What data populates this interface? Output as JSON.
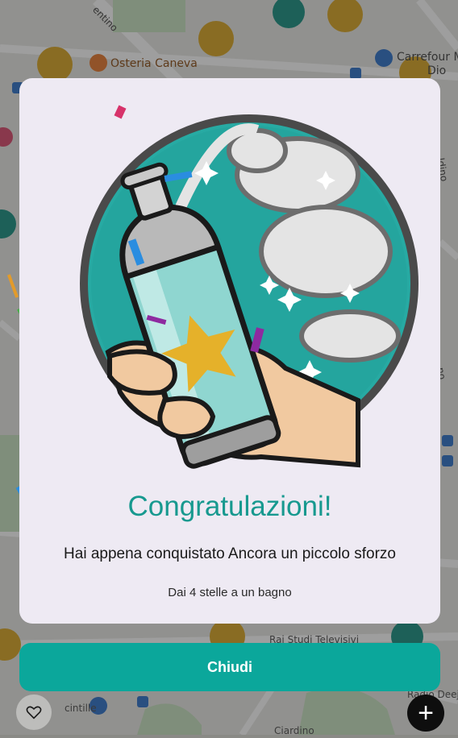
{
  "map": {
    "places": {
      "osteria": "Osteria Caneva",
      "carrefour_line1": "Carrefour M",
      "carrefour_line2": "Dio",
      "rai": "Rai Studi Televisivi",
      "radio": "Radio Deejay",
      "street_bottom": "cintille",
      "street_top": "entino",
      "street_right": "ldino",
      "street_right2": "no",
      "street_bottom2": "Ciardino"
    }
  },
  "dialog": {
    "title": "Congratulazioni!",
    "message": "Hai appena conquistato Ancora un piccolo sforzo",
    "subtitle": "Dai 4 stelle a un bagno"
  },
  "actions": {
    "close_label": "Chiudi",
    "add_symbol": "+"
  },
  "colors": {
    "accent": "#0ba79b",
    "title": "#17998f",
    "dialog_bg": "#eeeaf3"
  }
}
